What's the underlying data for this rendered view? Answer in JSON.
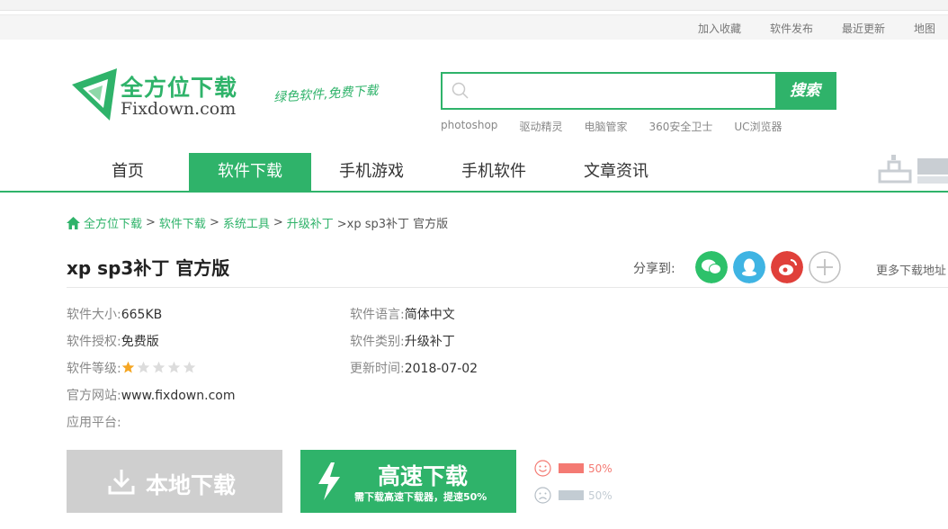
{
  "toplinks": [
    "加入收藏",
    "软件发布",
    "最近更新",
    "地图"
  ],
  "logo": {
    "name": "全方位下载",
    "domain": "Fixdown.com",
    "slogan": "绿色软件,免费下载"
  },
  "search": {
    "placeholder": "",
    "button": "搜索",
    "hotwords": [
      "photoshop",
      "驱动精灵",
      "电脑管家",
      "360安全卫士",
      "UC浏览器"
    ]
  },
  "nav": {
    "items": [
      "首页",
      "软件下载",
      "手机游戏",
      "手机软件",
      "文章资讯"
    ],
    "active_index": 1
  },
  "breadcrumb": {
    "items": [
      "全方位下载",
      "软件下载",
      "系统工具",
      "升级补丁"
    ],
    "current": ">xp sp3补丁 官方版",
    "separator": ">"
  },
  "title": "xp sp3补丁 官方版",
  "share": {
    "label": "分享到:",
    "icons": [
      "wechat-icon",
      "qq-icon",
      "weibo-icon",
      "plus-icon"
    ],
    "colors": [
      "#2dc16a",
      "#3fb4e3",
      "#e0403a",
      "#bfbfbf"
    ]
  },
  "more_link": "更多下载地址",
  "info": {
    "size_k": "软件大小:",
    "size_v": "665KB",
    "lang_k": "软件语言:",
    "lang_v": "简体中文",
    "license_k": "软件授权:",
    "license_v": "免费版",
    "category_k": "软件类别:",
    "category_v": "升级补丁",
    "rating_k": "软件等级:",
    "rating_stars": 1,
    "rating_max": 5,
    "update_k": "更新时间:",
    "update_v": "2018-07-02",
    "site_k": "官方网站:",
    "site_v": "www.fixdown.com",
    "platform_k": "应用平台:",
    "platform_v": ""
  },
  "buttons": {
    "local": "本地下载",
    "fast": "高速下载",
    "fast_sub": "需下载高速下载器，提速50%"
  },
  "votes": {
    "good": "50%",
    "bad": "50%",
    "good_color": "#f47a73",
    "bad_color": "#c3ccd3"
  },
  "colors": {
    "brand": "#2fb36a"
  }
}
